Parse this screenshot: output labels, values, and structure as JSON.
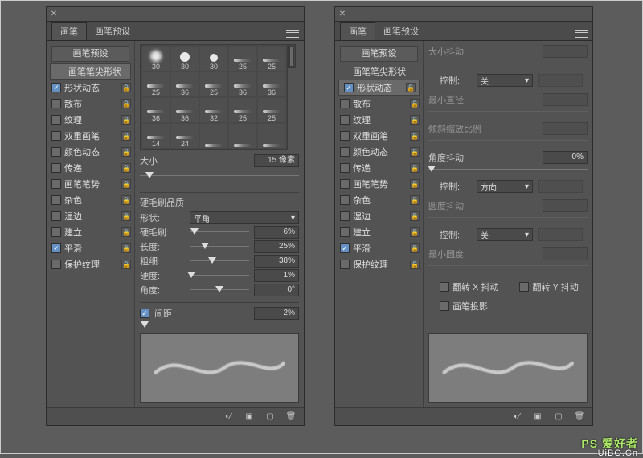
{
  "common": {
    "tabs": [
      "画笔",
      "画笔预设"
    ],
    "sideTop": "画笔预设",
    "tipShape": "画笔笔尖形状",
    "options": [
      {
        "label": "形状动态",
        "checked": true
      },
      {
        "label": "散布",
        "checked": false
      },
      {
        "label": "纹理",
        "checked": false
      },
      {
        "label": "双重画笔",
        "checked": false
      },
      {
        "label": "颜色动态",
        "checked": false
      },
      {
        "label": "传递",
        "checked": false
      },
      {
        "label": "画笔笔势",
        "checked": false
      },
      {
        "label": "杂色",
        "checked": false
      },
      {
        "label": "湿边",
        "checked": false
      },
      {
        "label": "建立",
        "checked": false
      },
      {
        "label": "平滑",
        "checked": true
      },
      {
        "label": "保护纹理",
        "checked": false
      }
    ]
  },
  "left": {
    "brushes": [
      "30",
      "30",
      "30",
      "25",
      "25",
      "25",
      "36",
      "25",
      "36",
      "36",
      "36",
      "36",
      "32",
      "25",
      "25",
      "14",
      "24",
      "-",
      "-",
      "-"
    ],
    "sizeLabel": "大小",
    "sizeVal": "15 像素",
    "sectTitle": "硬毛刷品质",
    "shapeLabel": "形状:",
    "shapeVal": "平角",
    "rows": [
      {
        "label": "硬毛刷:",
        "val": "6%",
        "pos": 8
      },
      {
        "label": "长度:",
        "val": "25%",
        "pos": 26
      },
      {
        "label": "粗细:",
        "val": "38%",
        "pos": 38
      },
      {
        "label": "硬度:",
        "val": "1%",
        "pos": 3
      },
      {
        "label": "角度:",
        "val": "0°",
        "pos": 50
      }
    ],
    "spacingLabel": "间距",
    "spacingVal": "2%"
  },
  "right": {
    "rows": [
      {
        "label": "大小抖动",
        "type": "disabled"
      },
      {
        "label": "控制:",
        "type": "select",
        "val": "关"
      },
      {
        "label": "最小直径",
        "type": "disabled"
      },
      {
        "label": "倾斜缩放比例",
        "type": "disabled"
      },
      {
        "label": "角度抖动",
        "type": "slider",
        "val": "0%",
        "pos": 2
      },
      {
        "label": "控制:",
        "type": "select",
        "val": "方向"
      },
      {
        "label": "圆度抖动",
        "type": "disabled"
      },
      {
        "label": "控制:",
        "type": "select",
        "val": "关"
      },
      {
        "label": "最小圆度",
        "type": "disabled"
      }
    ],
    "flipX": "翻转 X 抖动",
    "flipY": "翻转 Y 抖动",
    "proj": "画笔投影"
  },
  "watermark": {
    "a": "PS 爱好者",
    "b": "UiBO.Cn"
  }
}
